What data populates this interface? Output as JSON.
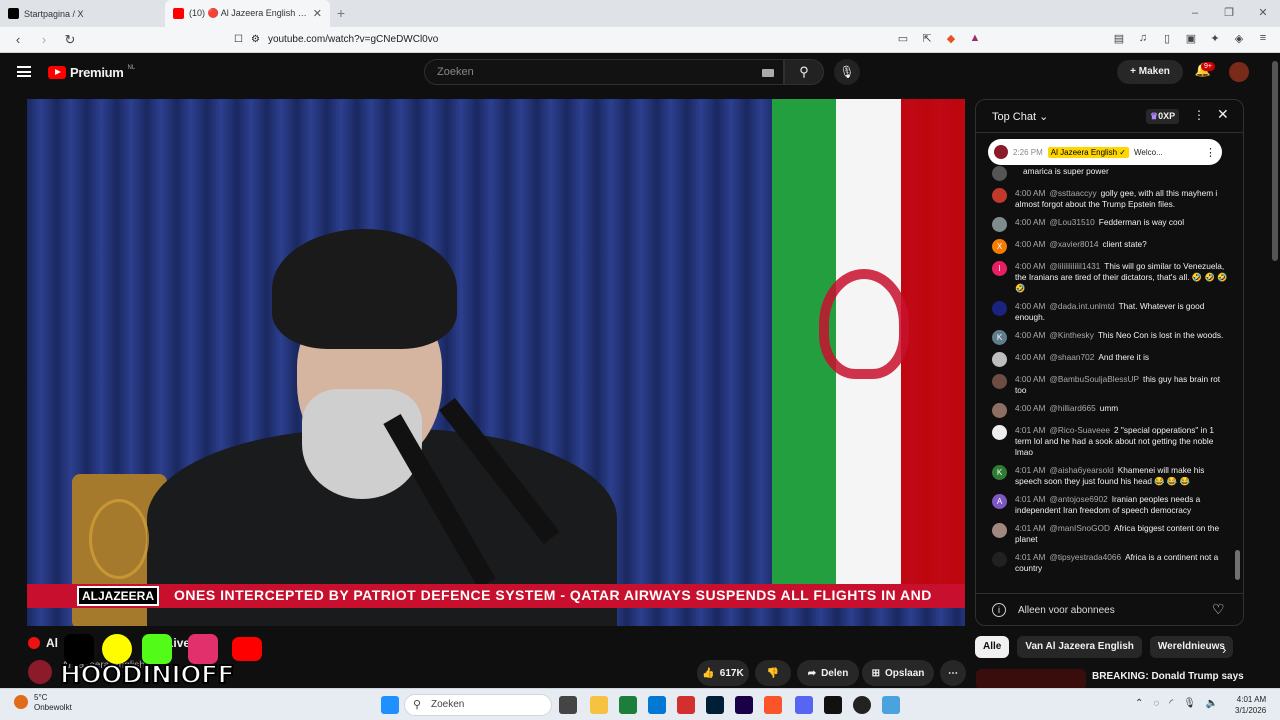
{
  "browser": {
    "tabs": [
      {
        "title": "Startpagina / X",
        "favicon_color": "#000000"
      },
      {
        "title": "(10) 🔴 Al Jazeera English | Li",
        "favicon_color": "#ff0000"
      }
    ],
    "url": "youtube.com/watch?v=gCNeDWCl0vo"
  },
  "youtube": {
    "logo_text": "Premium",
    "country": "NL",
    "search_placeholder": "Zoeken",
    "create_label": "Maken",
    "notification_count": "9+"
  },
  "video": {
    "watermark": "ALJAZEERA",
    "ticker": "ONES INTERCEPTED BY PATRIOT DEFENCE SYSTEM   -   QATAR AIRWAYS SUSPENDS ALL FLIGHTS IN AND"
  },
  "chat": {
    "title": "Top Chat",
    "points": "0XP",
    "pinned": {
      "time": "2:26 PM",
      "author": "Al Jazeera English",
      "text": "Welco..."
    },
    "messages": [
      {
        "time": "",
        "author": "",
        "text": "amarica is super power",
        "color": "#555555",
        "initial": ""
      },
      {
        "time": "4:00 AM",
        "author": "@ssttaaccyy",
        "text": "golly gee, with all this mayhem i almost forgot about the Trump Epstein files.",
        "color": "#c0392b",
        "initial": ""
      },
      {
        "time": "4:00 AM",
        "author": "@Lou31510",
        "text": "Fedderman is way cool",
        "color": "#7f8c8d",
        "initial": ""
      },
      {
        "time": "4:00 AM",
        "author": "@xavier8014",
        "text": "client state?",
        "color": "#f57c00",
        "initial": "X"
      },
      {
        "time": "4:00 AM",
        "author": "@lilililililil1431",
        "text": "This will go similar to Venezuela, the Iranians are tired of their dictators, that's all. 🤣 🤣 🤣 🤣",
        "color": "#e91e63",
        "initial": "l"
      },
      {
        "time": "4:00 AM",
        "author": "@dada.int.unlmtd",
        "text": "That. Whatever is good enough.",
        "color": "#1a237e",
        "initial": ""
      },
      {
        "time": "4:00 AM",
        "author": "@Kinthesky",
        "text": "This Neo Con is lost in the woods.",
        "color": "#607d8b",
        "initial": "K"
      },
      {
        "time": "4:00 AM",
        "author": "@shaan702",
        "text": "And there it is",
        "color": "#bdbdbd",
        "initial": ""
      },
      {
        "time": "4:00 AM",
        "author": "@BambuSouljaBlessUP",
        "text": "this guy has brain rot too",
        "color": "#6d4c41",
        "initial": ""
      },
      {
        "time": "4:00 AM",
        "author": "@hilliard665",
        "text": "umm",
        "color": "#8d6e63",
        "initial": ""
      },
      {
        "time": "4:01 AM",
        "author": "@Rico-Suaveee",
        "text": "2 \"special opperations\" in 1 term lol and he had a sook about not getting the noble lmao",
        "color": "#eeeeee",
        "initial": ""
      },
      {
        "time": "4:01 AM",
        "author": "@aisha6yearsold",
        "text": "Khamenei will make his speech soon they just found his head 😂 😂 😂",
        "color": "#2e7d32",
        "initial": "K"
      },
      {
        "time": "4:01 AM",
        "author": "@antojose6902",
        "text": "Iranian peoples needs a independent Iran freedom of speech democracy",
        "color": "#7e57c2",
        "initial": "A"
      },
      {
        "time": "4:01 AM",
        "author": "@manISnoGOD",
        "text": "Africa biggest content on the planet",
        "color": "#a1887f",
        "initial": ""
      },
      {
        "time": "4:01 AM",
        "author": "@tipsyestrada4066",
        "text": "Africa is a continent not a country",
        "color": "#212121",
        "initial": ""
      }
    ],
    "footer_label": "Alleen voor abonnees"
  },
  "below": {
    "title_prefix": "Al",
    "title_mid": "eer",
    "title_suffix": "Live",
    "channel": "Al Jazeera English",
    "overlay_text": "HOODINIOFF",
    "likes": "617K",
    "share_label": "Delen",
    "save_label": "Opslaan",
    "chips": [
      "Alle",
      "Van Al Jazeera English",
      "Wereldnieuws"
    ],
    "related_title": "BREAKING: Donald Trump says"
  },
  "taskbar": {
    "temp": "5°C",
    "weather": "Onbewolkt",
    "search": "Zoeken",
    "time": "4:01 AM",
    "date": "3/1/2026"
  }
}
